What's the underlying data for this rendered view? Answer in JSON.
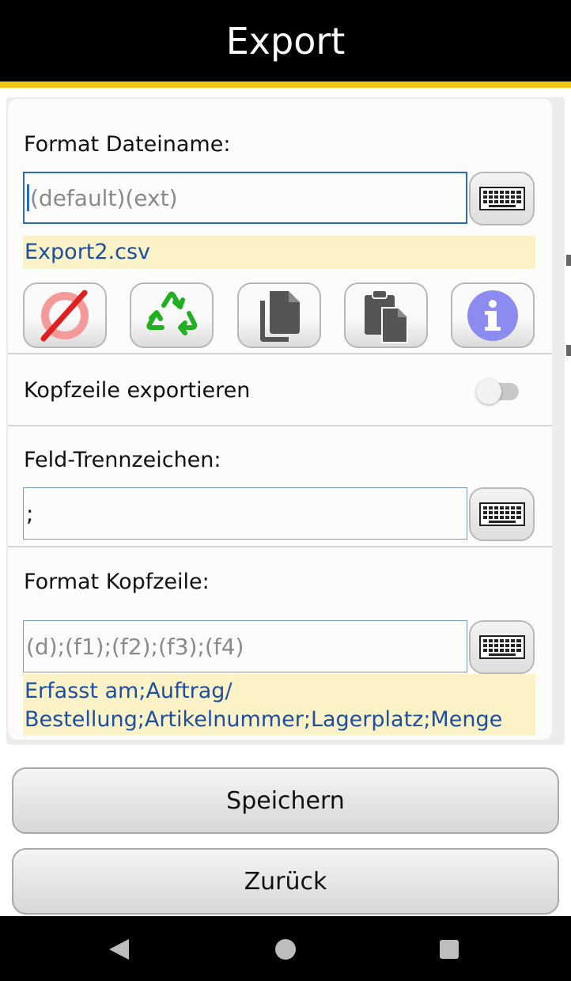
{
  "header": {
    "title": "Export"
  },
  "form": {
    "filename": {
      "label": "Format Dateiname:",
      "placeholder": "(default)(ext)",
      "value": "",
      "preview": "Export2.csv"
    },
    "header_export": {
      "label": "Kopfzeile exportieren",
      "enabled": false
    },
    "separator": {
      "label": "Feld-Trennzeichen:",
      "value": ";"
    },
    "header_format": {
      "label": "Format Kopfzeile:",
      "placeholder": "(d);(f1);(f2);(f3);(f4)",
      "preview_line1": "Erfasst am;Auftrag/",
      "preview_line2": "Bestellung;Artikelnummer;Lagerplatz;Menge"
    }
  },
  "icons": {
    "clear": "clear-icon",
    "reset": "recycle-icon",
    "copy": "copy-icon",
    "paste": "paste-icon",
    "info": "info-icon",
    "keyboard": "keyboard-icon"
  },
  "colors": {
    "accent": "#f5c518",
    "preview_bg": "#fcf2c8",
    "preview_text": "#1c4fa0",
    "focus": "#2a6bbf"
  },
  "actions": {
    "save": "Speichern",
    "back": "Zurück"
  }
}
